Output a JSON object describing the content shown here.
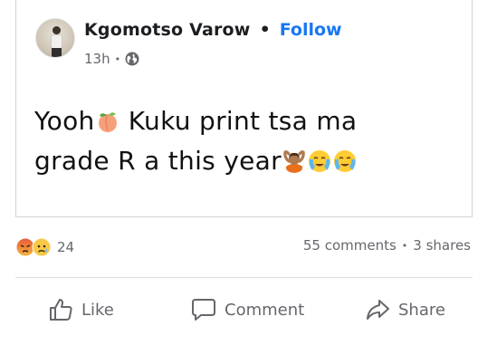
{
  "post": {
    "author": "Kgomotso Varow",
    "follow_label": "Follow",
    "separator": "•",
    "time": "13h",
    "meta_separator": "•",
    "privacy_icon": "globe-icon",
    "text_line1_a": "Yooh",
    "text_line1_b": " Kuku print tsa ma",
    "text_line2": "grade R a this year",
    "emojis": [
      "peach-emoji",
      "person-raising-hands-emoji",
      "crying-face-emoji",
      "crying-face-emoji"
    ]
  },
  "engagement": {
    "reaction_icons": [
      "angry-reaction-icon",
      "sad-reaction-icon"
    ],
    "reaction_count": "24",
    "comments": "55 comments",
    "stats_separator": "•",
    "shares": "3 shares"
  },
  "actions": {
    "like_label": "Like",
    "comment_label": "Comment",
    "share_label": "Share"
  },
  "colors": {
    "accent": "#1877f2",
    "muted_text": "#65676b",
    "border": "#d0d3d8"
  }
}
